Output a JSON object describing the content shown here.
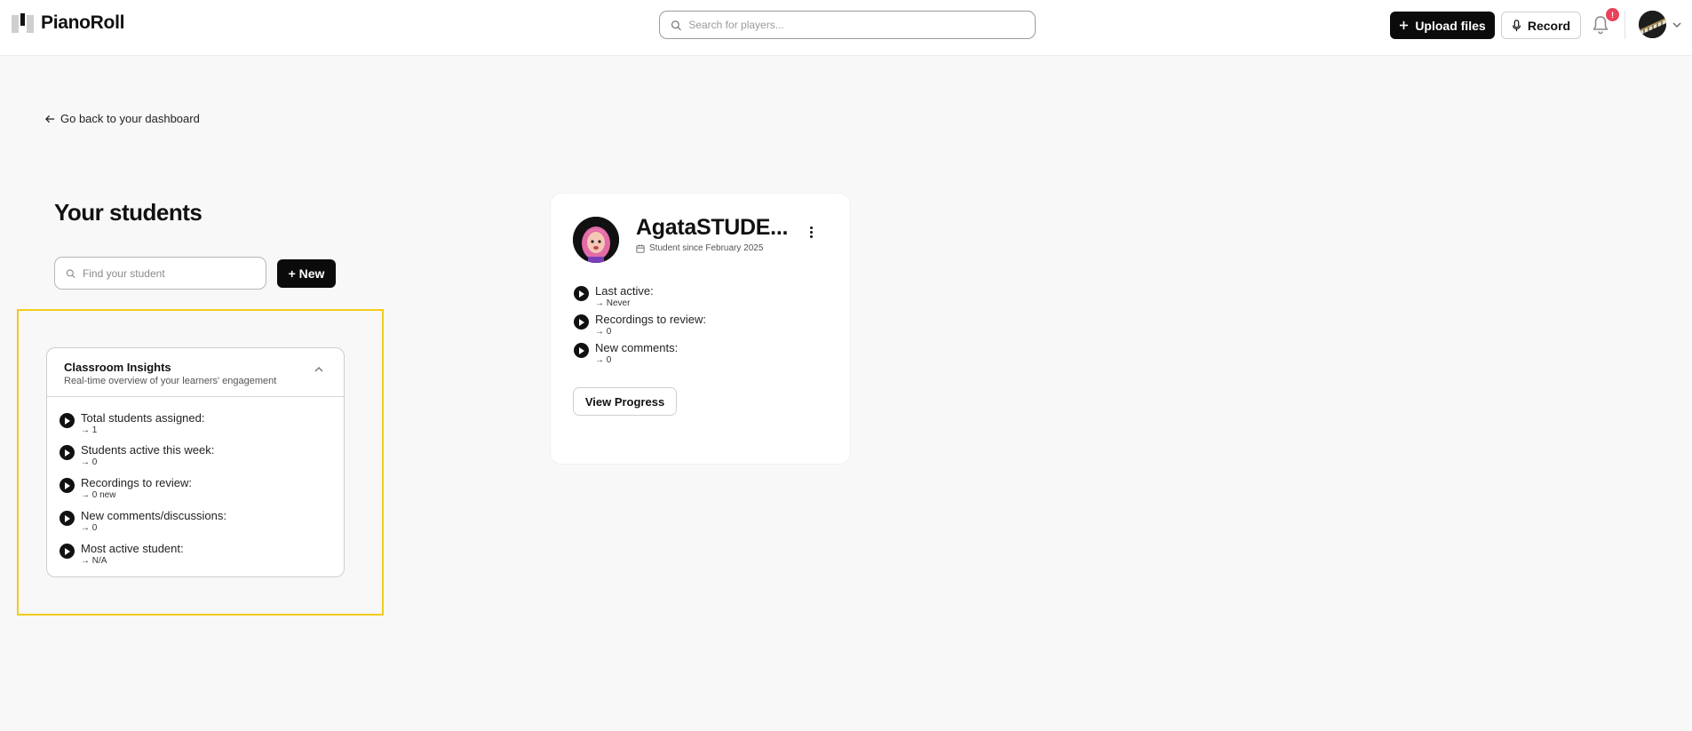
{
  "app": {
    "name": "PianoRoll"
  },
  "header": {
    "search_placeholder": "Search for players...",
    "upload_label": "Upload files",
    "record_label": "Record",
    "notification_count": "!"
  },
  "nav": {
    "back_label": "Go back to your dashboard"
  },
  "students": {
    "title": "Your students",
    "search_placeholder": "Find your student",
    "new_label": "+ New"
  },
  "insights": {
    "title": "Classroom Insights",
    "subtitle": "Real-time overview of your learners' engagement",
    "stats": [
      {
        "label": "Total students assigned:",
        "value": "→ 1"
      },
      {
        "label": "Students active this week:",
        "value": "→ 0"
      },
      {
        "label": "Recordings to review:",
        "value": "→ 0 new"
      },
      {
        "label": "New comments/discussions:",
        "value": "→ 0"
      },
      {
        "label": "Most active student:",
        "value": "→ N/A"
      }
    ]
  },
  "student_card": {
    "name": "AgataSTUDE...",
    "since": "Student since February 2025",
    "stats": [
      {
        "label": "Last active:",
        "value": "→ Never"
      },
      {
        "label": "Recordings to review:",
        "value": "→ 0"
      },
      {
        "label": "New comments:",
        "value": "→ 0"
      }
    ],
    "progress_label": "View Progress"
  },
  "colors": {
    "accent_black": "#0b0b0b",
    "highlight_yellow": "#f2cc1a",
    "notification_red": "#e8435a",
    "page_bg": "#f8f8f8"
  }
}
